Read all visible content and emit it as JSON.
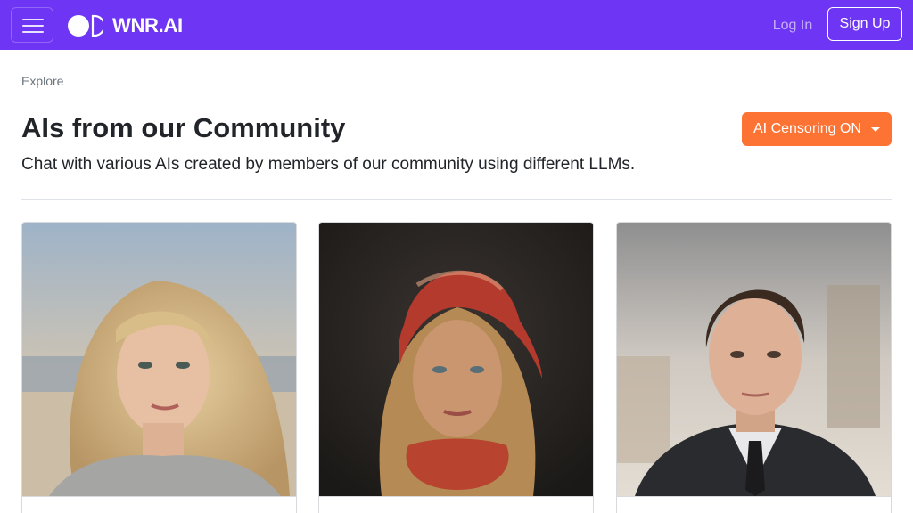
{
  "navbar": {
    "brand_name": "WNR.AI",
    "login_label": "Log In",
    "signup_label": "Sign Up",
    "background_color": "#6e35f5",
    "icons": [
      "menu-icon",
      "brand-logo-icon"
    ]
  },
  "breadcrumb": {
    "label": "Explore"
  },
  "header": {
    "title": "AIs from our Community",
    "subtitle": "Chat with various AIs created by members of our community using different LLMs.",
    "censor_button_label": "AI Censoring ON",
    "censor_button_color": "#fd7334"
  },
  "cards": [
    {
      "portrait": "blonde woman on beach"
    },
    {
      "portrait": "woman with red headscarf"
    },
    {
      "portrait": "man in dark suit"
    }
  ]
}
